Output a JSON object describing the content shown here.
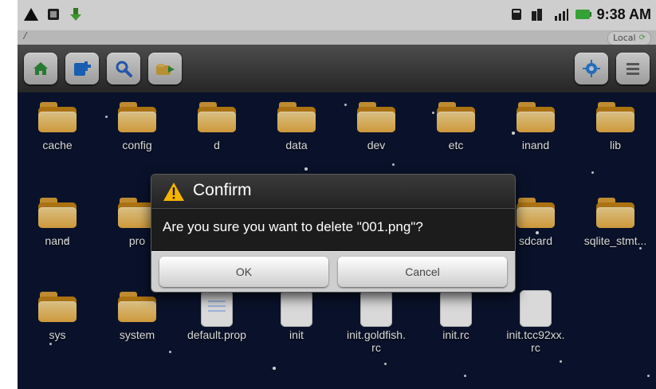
{
  "status_bar": {
    "left_icons": [
      "warning-icon",
      "sim-icon",
      "usb-download-icon"
    ],
    "right_icons": [
      "sd-card-icon",
      "network-icon",
      "signal-icon",
      "battery-icon"
    ],
    "time": "9:38 AM"
  },
  "path_bar": {
    "path": "/",
    "location": "Local"
  },
  "toolbar": {
    "left_icons": [
      "home-icon",
      "new-folder-icon",
      "search-icon",
      "move-folder-icon"
    ],
    "right_icons": [
      "settings-icon",
      "list-view-icon"
    ]
  },
  "files": [
    {
      "name": "cache",
      "type": "folder"
    },
    {
      "name": "config",
      "type": "folder"
    },
    {
      "name": "d",
      "type": "folder"
    },
    {
      "name": "data",
      "type": "folder"
    },
    {
      "name": "dev",
      "type": "folder"
    },
    {
      "name": "etc",
      "type": "folder"
    },
    {
      "name": "inand",
      "type": "folder"
    },
    {
      "name": "lib",
      "type": "folder"
    },
    {
      "name": "nand",
      "type": "folder"
    },
    {
      "name": "pro",
      "type": "folder"
    },
    {
      "name": "sdcard",
      "type": "folder"
    },
    {
      "name": "sqlite_stmt...",
      "type": "folder"
    },
    {
      "name": "sys",
      "type": "folder"
    },
    {
      "name": "system",
      "type": "folder"
    },
    {
      "name": "default.prop",
      "type": "file"
    },
    {
      "name": "init",
      "type": "file"
    },
    {
      "name": "init.goldfish.\nrc",
      "type": "file"
    },
    {
      "name": "init.rc",
      "type": "file"
    },
    {
      "name": "init.tcc92xx.\nrc",
      "type": "file"
    }
  ],
  "dialog": {
    "title": "Confirm",
    "message": "Are you sure you want to delete \"001.png\"?",
    "ok_label": "OK",
    "cancel_label": "Cancel"
  },
  "colors": {
    "background": "#0c1633",
    "folder": "#f2b447",
    "dialog": "#1c1c1c"
  }
}
